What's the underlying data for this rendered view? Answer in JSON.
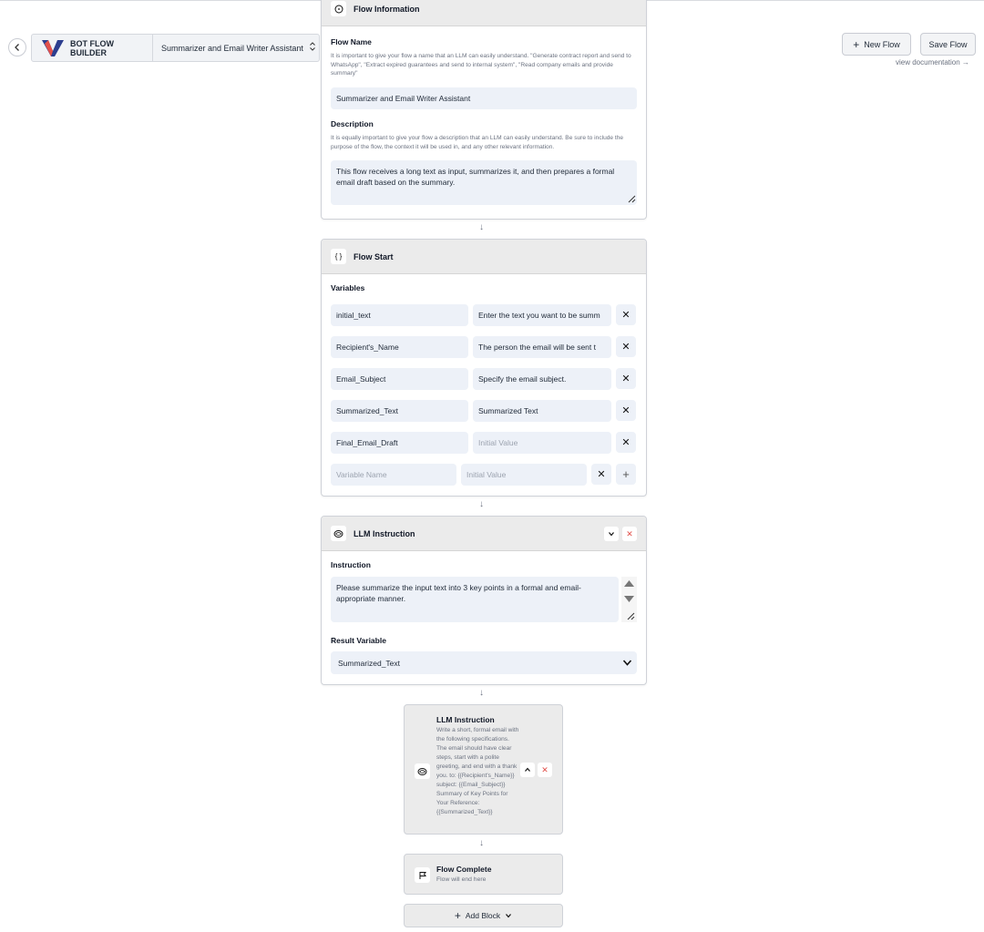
{
  "header": {
    "brand_title": "BOT FLOW BUILDER",
    "flow_selector": "Summarizer and Email Writer Assistant",
    "new_flow_label": "New Flow",
    "save_flow_label": "Save Flow",
    "doc_link": "view documentation →"
  },
  "flow_info": {
    "title": "Flow Information",
    "name_label": "Flow Name",
    "name_help": "It is important to give your flow a name that an LLM can easily understand. \"Generate contract report and send to WhatsApp\", \"Extract expired guarantees and send to internal system\", \"Read company emails and provide summary\"",
    "name_value": "Summarizer and Email Writer Assistant",
    "desc_label": "Description",
    "desc_help": "It is equally important to give your flow a description that an LLM can easily understand. Be sure to include the purpose of the flow, the context it will be used in, and any other relevant information.",
    "desc_value": "This flow receives a long text as input, summarizes it, and then prepares a formal email draft based on the summary."
  },
  "flow_start": {
    "title": "Flow Start",
    "variables_label": "Variables",
    "variables": [
      {
        "name": "initial_text",
        "value": "Enter the text you want to be summ"
      },
      {
        "name": "Recipient's_Name",
        "value": " The person the email will be sent t"
      },
      {
        "name": "Email_Subject",
        "value": " Specify the email subject."
      },
      {
        "name": "Summarized_Text",
        "value": "Summarized Text"
      },
      {
        "name": "Final_Email_Draft",
        "value": ""
      }
    ],
    "name_placeholder": "Variable Name",
    "value_placeholder": "Initial Value"
  },
  "llm1": {
    "title": "LLM Instruction",
    "instruction_label": "Instruction",
    "instruction_value": "Please summarize the input text into 3 key points in a formal and email-appropriate manner.",
    "result_label": "Result Variable",
    "result_value": "Summarized_Text"
  },
  "llm2": {
    "title": "LLM Instruction",
    "text": "Write a short, formal email with the following specifications. The email should have clear steps, start with a polite greeting, and end with a thank you. to: {{Recipient's_Name}} subject: {{Email_Subject}} Summary of Key Points for Your Reference: {{Summarized_Text}}"
  },
  "flow_complete": {
    "title": "Flow Complete",
    "subtitle": "Flow will end here"
  },
  "add_block_label": "Add Block",
  "icons": {
    "arrow": "↓",
    "close": "✕"
  },
  "colors": {
    "field_bg": "#edf1f8",
    "head_bg": "#ebebeb",
    "accent_red": "#e2504a",
    "logo_blue": "#2c3e8f"
  }
}
